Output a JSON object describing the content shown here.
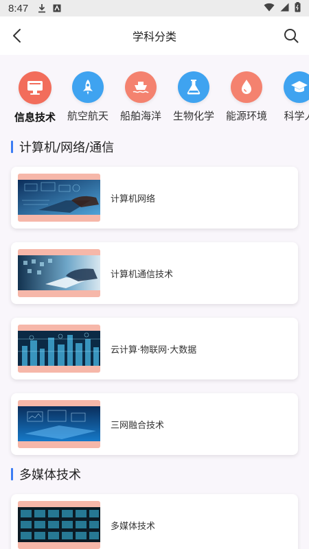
{
  "status_bar": {
    "time": "8:47"
  },
  "header": {
    "title": "学科分类"
  },
  "categories": [
    {
      "label": "信息技术",
      "icon": "monitor-icon",
      "color": "#f26d5b",
      "active": true
    },
    {
      "label": "航空航天",
      "icon": "rocket-icon",
      "color": "#3fa3f0",
      "active": false
    },
    {
      "label": "船舶海洋",
      "icon": "ship-icon",
      "color": "#f4826f",
      "active": false
    },
    {
      "label": "生物化学",
      "icon": "flask-icon",
      "color": "#3fa3f0",
      "active": false
    },
    {
      "label": "能源环境",
      "icon": "drop-icon",
      "color": "#f4826f",
      "active": false
    },
    {
      "label": "科学人",
      "icon": "graduation-cap-icon",
      "color": "#3fa3f0",
      "active": false
    }
  ],
  "sections": [
    {
      "title": "计算机/网络/通信",
      "items": [
        {
          "name": "计算机网络"
        },
        {
          "name": "计算机通信技术"
        },
        {
          "name": "云计算·物联网·大数据"
        },
        {
          "name": "三网融合技术"
        }
      ]
    },
    {
      "title": "多媒体技术",
      "items": [
        {
          "name": "多媒体技术"
        }
      ]
    }
  ],
  "colors": {
    "accent": "#3b7cf4",
    "thumb_bg": "#f6b7a9"
  }
}
